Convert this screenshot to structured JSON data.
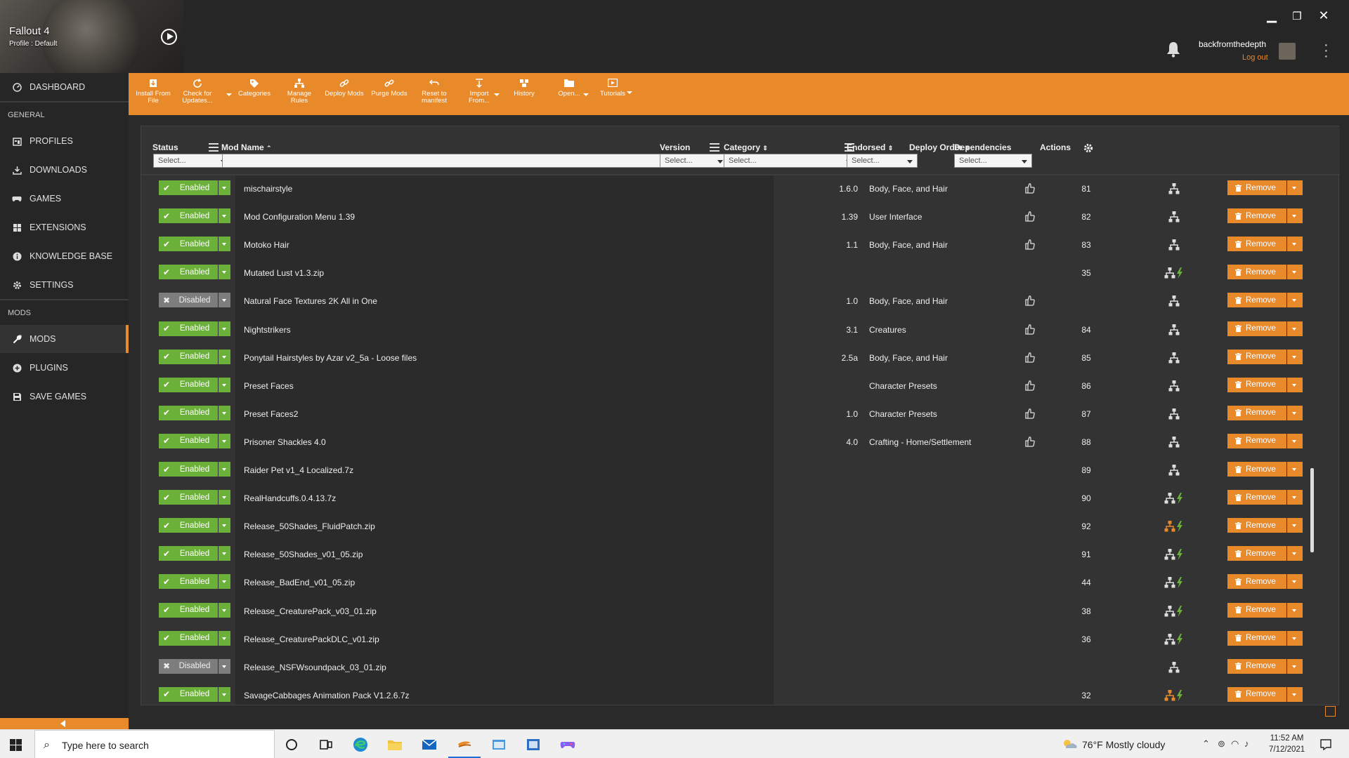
{
  "game": {
    "title": "Fallout 4",
    "profile": "Profile : Default"
  },
  "user": {
    "name": "backfromthedepth",
    "logout": "Log out"
  },
  "window_controls": {
    "minimize": "▁",
    "restore": "❐",
    "close": "✕"
  },
  "sidebar": {
    "top_items": [
      {
        "label": "DASHBOARD",
        "icon": "dashboard-icon"
      }
    ],
    "section_general": "GENERAL",
    "general_items": [
      {
        "label": "PROFILES",
        "icon": "profiles-icon"
      },
      {
        "label": "DOWNLOADS",
        "icon": "download-icon"
      },
      {
        "label": "GAMES",
        "icon": "gamepad-icon"
      },
      {
        "label": "EXTENSIONS",
        "icon": "extensions-icon"
      },
      {
        "label": "KNOWLEDGE BASE",
        "icon": "info-icon"
      },
      {
        "label": "SETTINGS",
        "icon": "gear-icon"
      }
    ],
    "section_mods": "MODS",
    "mods_items": [
      {
        "label": "MODS",
        "icon": "wrench-icon",
        "active": true
      },
      {
        "label": "PLUGINS",
        "icon": "plugin-icon"
      },
      {
        "label": "SAVE GAMES",
        "icon": "save-icon"
      }
    ]
  },
  "toolbar": {
    "buttons": [
      {
        "label": "Install From File",
        "l1": "Install From",
        "l2": "File"
      },
      {
        "label": "Check for Updates...",
        "l1": "Check for",
        "l2": "Updates..."
      },
      {
        "label": "Categories",
        "l1": "Categories",
        "l2": ""
      },
      {
        "label": "Manage Rules",
        "l1": "Manage",
        "l2": "Rules"
      },
      {
        "label": "Deploy Mods",
        "l1": "Deploy Mods",
        "l2": ""
      },
      {
        "label": "Purge Mods",
        "l1": "Purge Mods",
        "l2": ""
      },
      {
        "label": "Reset to manifest",
        "l1": "Reset to",
        "l2": "manifest"
      },
      {
        "label": "Import From...",
        "l1": "Import",
        "l2": "From..."
      },
      {
        "label": "History",
        "l1": "History",
        "l2": ""
      },
      {
        "label": "Open...",
        "l1": "Open...",
        "l2": ""
      },
      {
        "label": "Tutorials",
        "l1": "Tutorials",
        "l2": ""
      }
    ]
  },
  "table": {
    "columns": {
      "status": "Status",
      "mod_name": "Mod Name",
      "version": "Version",
      "category": "Category",
      "endorsed": "Endorsed",
      "deploy_order": "Deploy Order",
      "dependencies": "Dependencies",
      "actions": "Actions"
    },
    "filter_placeholder": "Select...",
    "name_filter_value": "",
    "remove_label": "Remove",
    "rows": [
      {
        "status": "Enabled",
        "name": "mischairstyle",
        "version": "1.6.0",
        "category": "Body, Face, and Hair",
        "endorse": true,
        "order": "81",
        "deps": "plain"
      },
      {
        "status": "Enabled",
        "name": "Mod Configuration Menu 1.39",
        "version": "1.39",
        "category": "User Interface",
        "endorse": true,
        "order": "82",
        "deps": "plain"
      },
      {
        "status": "Enabled",
        "name": "Motoko Hair",
        "version": "1.1",
        "category": "Body, Face, and Hair",
        "endorse": true,
        "order": "83",
        "deps": "plain"
      },
      {
        "status": "Enabled",
        "name": "Mutated Lust v1.3.zip",
        "version": "",
        "category": "",
        "endorse": false,
        "order": "35",
        "deps": "bolt"
      },
      {
        "status": "Disabled",
        "name": "Natural Face Textures 2K All in One",
        "version": "1.0",
        "category": "Body, Face, and Hair",
        "endorse": true,
        "order": "",
        "deps": "plain"
      },
      {
        "status": "Enabled",
        "name": "Nightstrikers",
        "version": "3.1",
        "category": "Creatures",
        "endorse": true,
        "order": "84",
        "deps": "plain"
      },
      {
        "status": "Enabled",
        "name": "Ponytail Hairstyles by Azar v2_5a - Loose files",
        "version": "2.5a",
        "category": "Body, Face, and Hair",
        "endorse": true,
        "order": "85",
        "deps": "plain"
      },
      {
        "status": "Enabled",
        "name": "Preset Faces",
        "version": "",
        "category": "Character Presets",
        "endorse": true,
        "order": "86",
        "deps": "plain"
      },
      {
        "status": "Enabled",
        "name": "Preset Faces2",
        "version": "1.0",
        "category": "Character Presets",
        "endorse": true,
        "order": "87",
        "deps": "plain"
      },
      {
        "status": "Enabled",
        "name": "Prisoner Shackles 4.0",
        "version": "4.0",
        "category": "Crafting - Home/Settlement",
        "endorse": true,
        "order": "88",
        "deps": "plain"
      },
      {
        "status": "Enabled",
        "name": "Raider Pet v1_4 Localized.7z",
        "version": "",
        "category": "",
        "endorse": false,
        "order": "89",
        "deps": "plain"
      },
      {
        "status": "Enabled",
        "name": "RealHandcuffs.0.4.13.7z",
        "version": "",
        "category": "",
        "endorse": false,
        "order": "90",
        "deps": "bolt"
      },
      {
        "status": "Enabled",
        "name": "Release_50Shades_FluidPatch.zip",
        "version": "",
        "category": "",
        "endorse": false,
        "order": "92",
        "deps": "bolt-orange"
      },
      {
        "status": "Enabled",
        "name": "Release_50Shades_v01_05.zip",
        "version": "",
        "category": "",
        "endorse": false,
        "order": "91",
        "deps": "bolt"
      },
      {
        "status": "Enabled",
        "name": "Release_BadEnd_v01_05.zip",
        "version": "",
        "category": "",
        "endorse": false,
        "order": "44",
        "deps": "bolt"
      },
      {
        "status": "Enabled",
        "name": "Release_CreaturePack_v03_01.zip",
        "version": "",
        "category": "",
        "endorse": false,
        "order": "38",
        "deps": "bolt"
      },
      {
        "status": "Enabled",
        "name": "Release_CreaturePackDLC_v01.zip",
        "version": "",
        "category": "",
        "endorse": false,
        "order": "36",
        "deps": "bolt"
      },
      {
        "status": "Disabled",
        "name": "Release_NSFWsoundpack_03_01.zip",
        "version": "",
        "category": "",
        "endorse": false,
        "order": "",
        "deps": "plain"
      },
      {
        "status": "Enabled",
        "name": "SavageCabbages Animation Pack V1.2.6.7z",
        "version": "",
        "category": "",
        "endorse": false,
        "order": "32",
        "deps": "bolt-orange"
      }
    ]
  },
  "taskbar": {
    "search_placeholder": "Type here to search",
    "weather": "76°F  Mostly cloudy",
    "time": "11:52 AM",
    "date": "7/12/2021"
  },
  "colors": {
    "accent": "#e8892a",
    "enabled": "#6ab039",
    "disabled": "#7d7d7d",
    "bolt": "#6ab039"
  }
}
